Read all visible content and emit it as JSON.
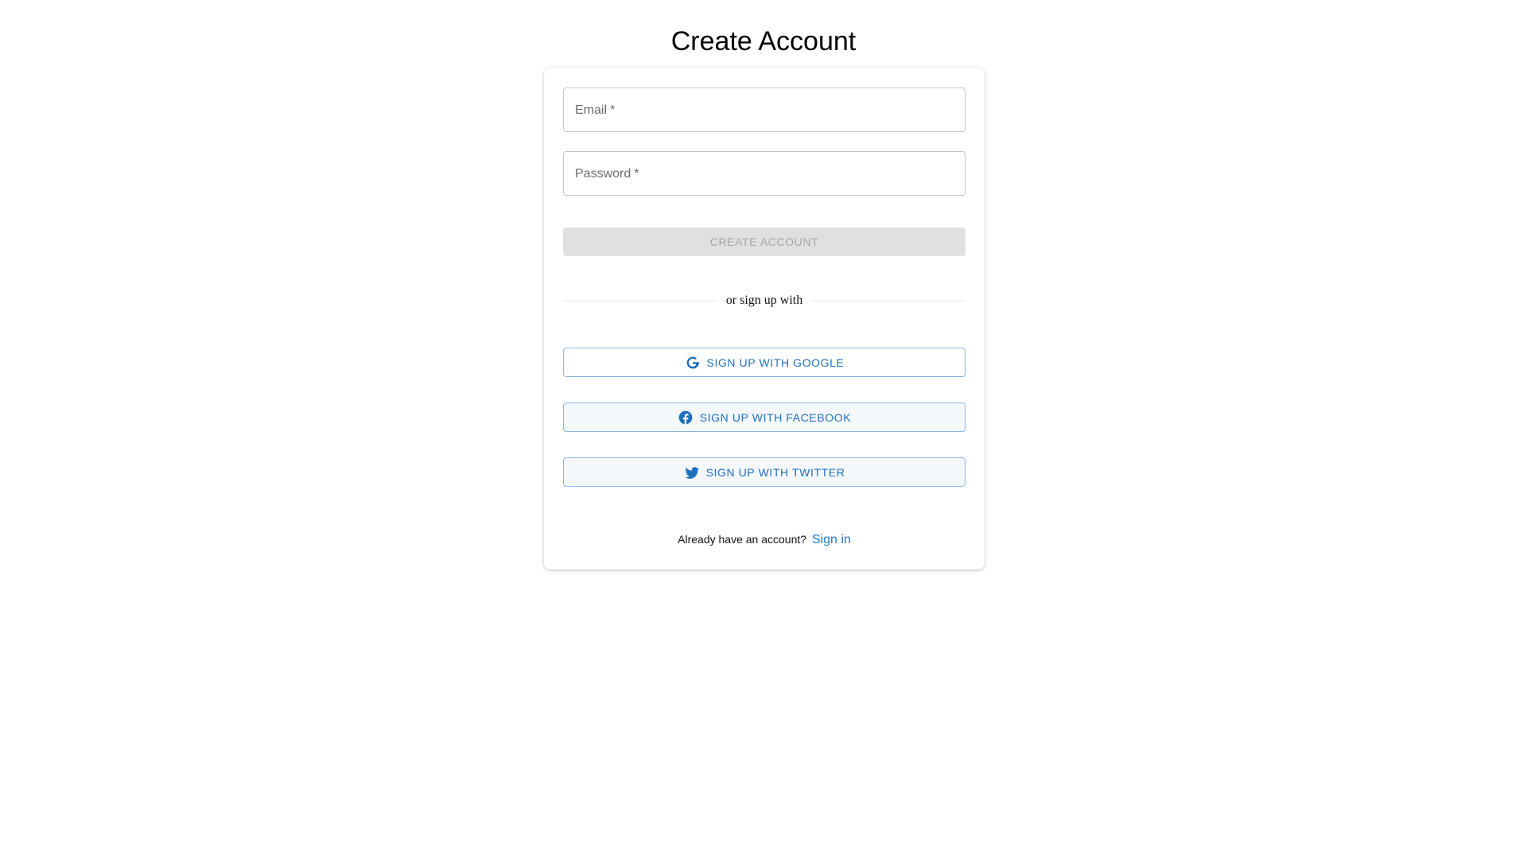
{
  "page": {
    "title": "Create Account"
  },
  "form": {
    "email": {
      "label": "Email",
      "required_mark": "*",
      "value": ""
    },
    "password": {
      "label": "Password",
      "required_mark": "*",
      "value": ""
    },
    "create_button": {
      "label": "CREATE ACCOUNT",
      "state": "disabled"
    },
    "divider_text": "or sign up with"
  },
  "social": [
    {
      "id": "google",
      "label": "SIGN UP WITH GOOGLE",
      "icon": "google-icon"
    },
    {
      "id": "facebook",
      "label": "SIGN UP WITH FACEBOOK",
      "icon": "facebook-icon"
    },
    {
      "id": "twitter",
      "label": "SIGN UP WITH TWITTER",
      "icon": "twitter-icon"
    }
  ],
  "footer": {
    "prompt": "Already have an account?",
    "link_label": "Sign in"
  },
  "colors": {
    "accent": "#1f76c7",
    "disabled_bg": "#e0e0e0",
    "disabled_text": "#a6a6a6",
    "social_border": "#8cb6e2"
  }
}
